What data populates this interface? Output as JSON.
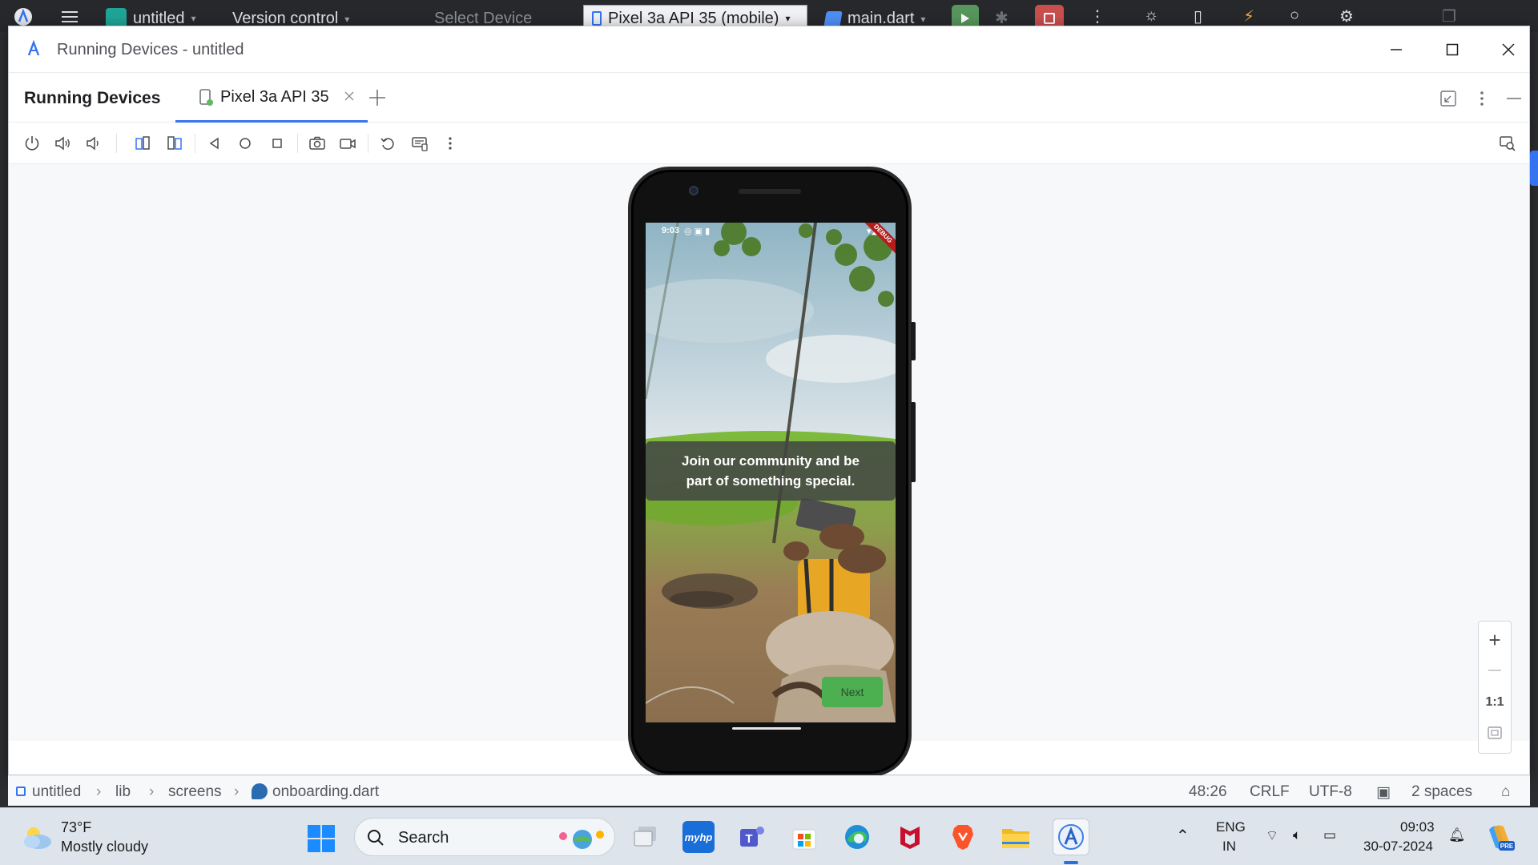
{
  "ide_topbar": {
    "project_name": "untitled",
    "vcs_label": "Version control",
    "select_device": "Select Device",
    "device_selector": "Pixel 3a API 35 (mobile)",
    "run_config": "main.dart"
  },
  "window": {
    "title": "Running Devices - untitled",
    "tool_title": "Running Devices",
    "device_tab_label": "Pixel 3a API 35"
  },
  "toolbar": {
    "buttons": [
      "power-icon",
      "volume-up-icon",
      "volume-down-icon",
      "rotate-left-icon",
      "rotate-right-icon",
      "back-icon",
      "home-icon",
      "overview-icon",
      "screenshot-icon",
      "screen-record-icon",
      "reset-icon",
      "keyboard-icon",
      "more-icon"
    ]
  },
  "phone_screen": {
    "status_time": "9:03",
    "caption": "Join our community and be part of something special.",
    "next_label": "Next",
    "debug_banner": "DEBUG"
  },
  "zoom": {
    "plus": "+",
    "minus": "—",
    "actual_size": "1:1"
  },
  "statusline": {
    "breadcrumbs": [
      "untitled",
      "lib",
      "screens",
      "onboarding.dart"
    ],
    "cursor_position": "48:26",
    "line_separator": "CRLF",
    "encoding": "UTF-8",
    "indent": "2 spaces"
  },
  "taskbar": {
    "weather_temp": "73°F",
    "weather_desc": "Mostly cloudy",
    "search_label": "Search",
    "language": "ENG",
    "region": "IN",
    "clock_time": "09:03",
    "clock_date": "30-07-2024",
    "copilot_badge": "PRE"
  },
  "colors": {
    "accent": "#3574f0",
    "next_button": "#4caf50",
    "taskbar_bg": "#dde4ec"
  }
}
